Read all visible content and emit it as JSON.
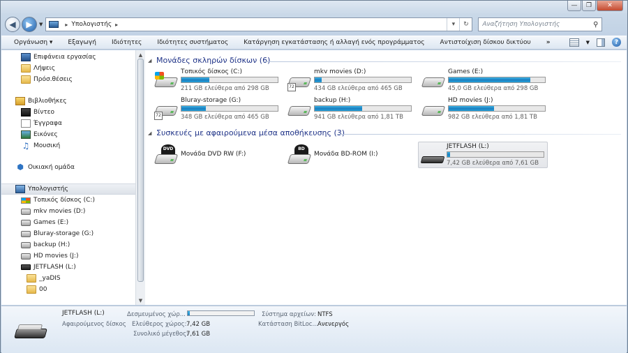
{
  "window": {
    "caption_buttons": [
      "—",
      "❐",
      "✕"
    ]
  },
  "address": {
    "path": "Υπολογιστής",
    "search_placeholder": "Αναζήτηση Υπολογιστής"
  },
  "toolbar": {
    "items": [
      "Οργάνωση ▾",
      "Εξαγωγή",
      "Ιδιότητες",
      "Ιδιότητες συστήματος",
      "Κατάργηση εγκατάστασης ή αλλαγή ενός προγράμματος",
      "Αντιστοίχιση δίσκου δικτύου",
      "»"
    ]
  },
  "nav": {
    "favorites": [
      "Επιφάνεια εργασίας",
      "Λήψεις",
      "Πρόσ.θέσεις"
    ],
    "libraries_header": "Βιβλιοθήκες",
    "libraries": [
      "Βίντεο",
      "Έγγραφα",
      "Εικόνες",
      "Μουσική"
    ],
    "homegroup": "Οικιακή ομάδα",
    "computer": "Υπολογιστής",
    "drives": [
      "Τοπικός δίσκος (C:)",
      "mkv movies (D:)",
      "Games (E:)",
      "Bluray-storage  (G:)",
      "backup (H:)",
      "HD movies  (J:)",
      "JETFLASH (L:)"
    ],
    "subfolders": [
      "_yaDIS",
      "00"
    ]
  },
  "content": {
    "hdd_group": "Μονάδες σκληρών δίσκων (6)",
    "removable_group": "Συσκευές με αφαιρούμενα μέσα αποθήκευσης (3)",
    "hdds": [
      {
        "name": "Τοπικός δίσκος (C:)",
        "free": "211 GB ελεύθερα από 298 GB",
        "used_fraction": 0.29
      },
      {
        "name": "mkv movies (D:)",
        "free": "434 GB ελεύθερα από 465 GB",
        "used_fraction": 0.07
      },
      {
        "name": "Games (E:)",
        "free": "45,0 GB ελεύθερα από 298 GB",
        "used_fraction": 0.85
      },
      {
        "name": "Bluray-storage  (G:)",
        "free": "348 GB ελεύθερα από 465 GB",
        "used_fraction": 0.25
      },
      {
        "name": "backup (H:)",
        "free": "941 GB ελεύθερα από 1,81 TB",
        "used_fraction": 0.49
      },
      {
        "name": "HD movies  (J:)",
        "free": "982 GB ελεύθερα από 1,81 TB",
        "used_fraction": 0.47
      }
    ],
    "removables": [
      {
        "name": "Μονάδα DVD RW (F:)",
        "badge": "DVD"
      },
      {
        "name": "Μονάδα BD-ROM (I:)",
        "badge": "BD"
      },
      {
        "name": "JETFLASH (L:)",
        "free": "7,42 GB ελεύθερα από 7,61 GB",
        "used_fraction": 0.03
      }
    ]
  },
  "details": {
    "name": "JETFLASH (L:)",
    "type": "Αφαιρούμενος δίσκος",
    "used_label": "Δεσμευμένος χώρ...",
    "free_label": "Ελεύθερος χώρος:",
    "free_value": "7,42 GB",
    "total_label": "Συνολικό μέγεθος:",
    "total_value": "7,61 GB",
    "fs_label": "Σύστημα αρχείων:",
    "fs_value": "NTFS",
    "bitlocker_label": "Κατάσταση BitLoc...",
    "bitlocker_value": "Ανενεργός",
    "used_fraction": 0.03
  }
}
